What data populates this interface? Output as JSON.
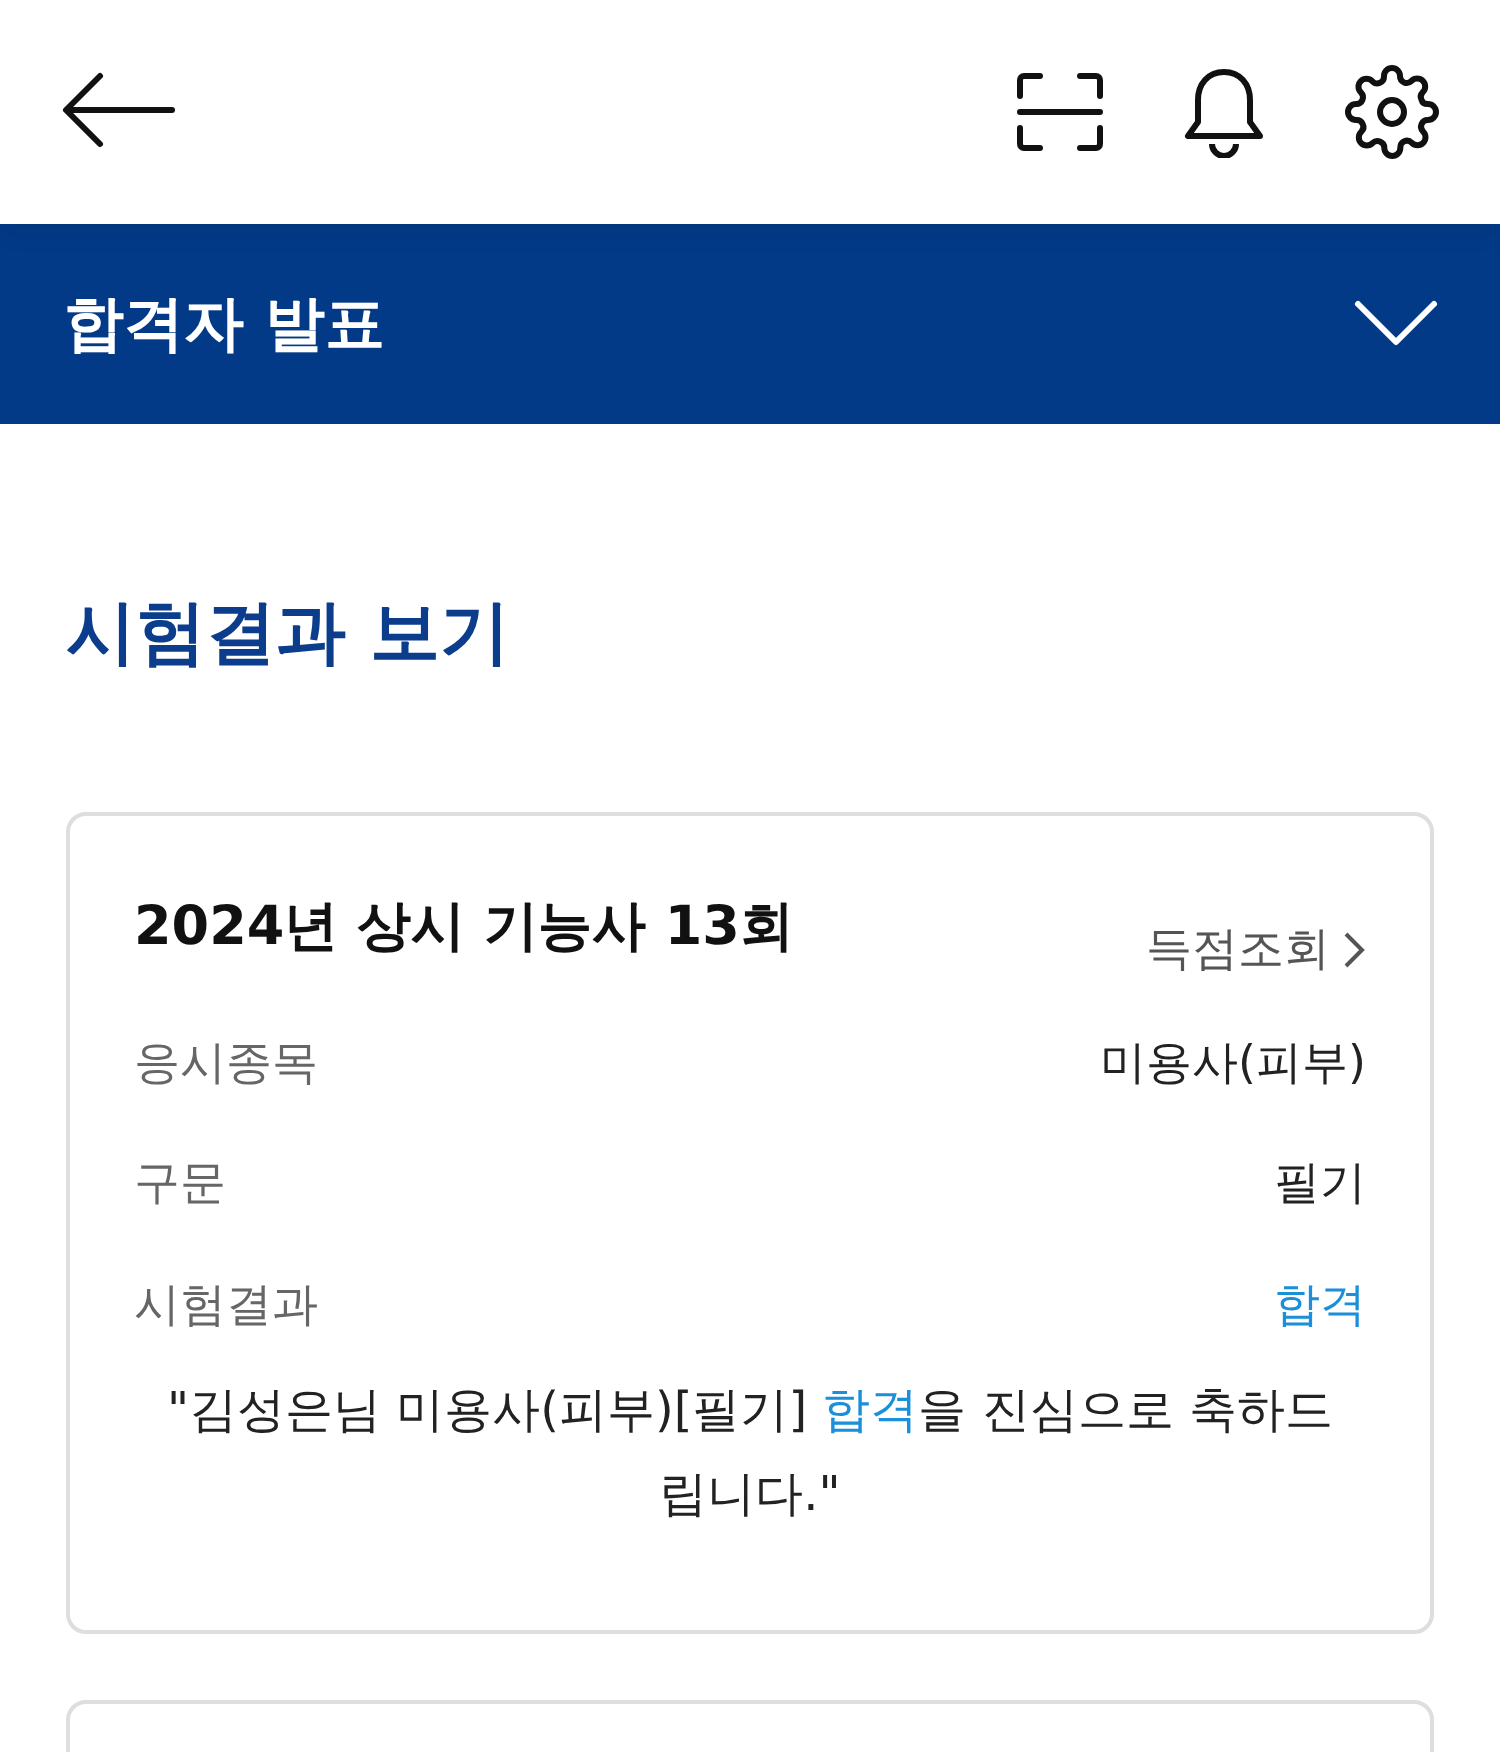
{
  "section_bar": {
    "title": "합격자 발표",
    "expanded": false
  },
  "heading": "시험결과 보기",
  "result_card": {
    "title": "2024년 상시 기능사 13회",
    "link": "득점조회",
    "rows": [
      {
        "label": "응시종목",
        "value": "미용사(피부)",
        "emphasis": false
      },
      {
        "label": "구문",
        "value": "필기",
        "emphasis": false
      },
      {
        "label": "시험결과",
        "value": "합격",
        "emphasis": true
      }
    ],
    "message": {
      "before": "\"김성은님 미용사(피부)[필기] ",
      "highlight": "합격",
      "after": "을 진심으로 축하드립니다.\""
    }
  }
}
